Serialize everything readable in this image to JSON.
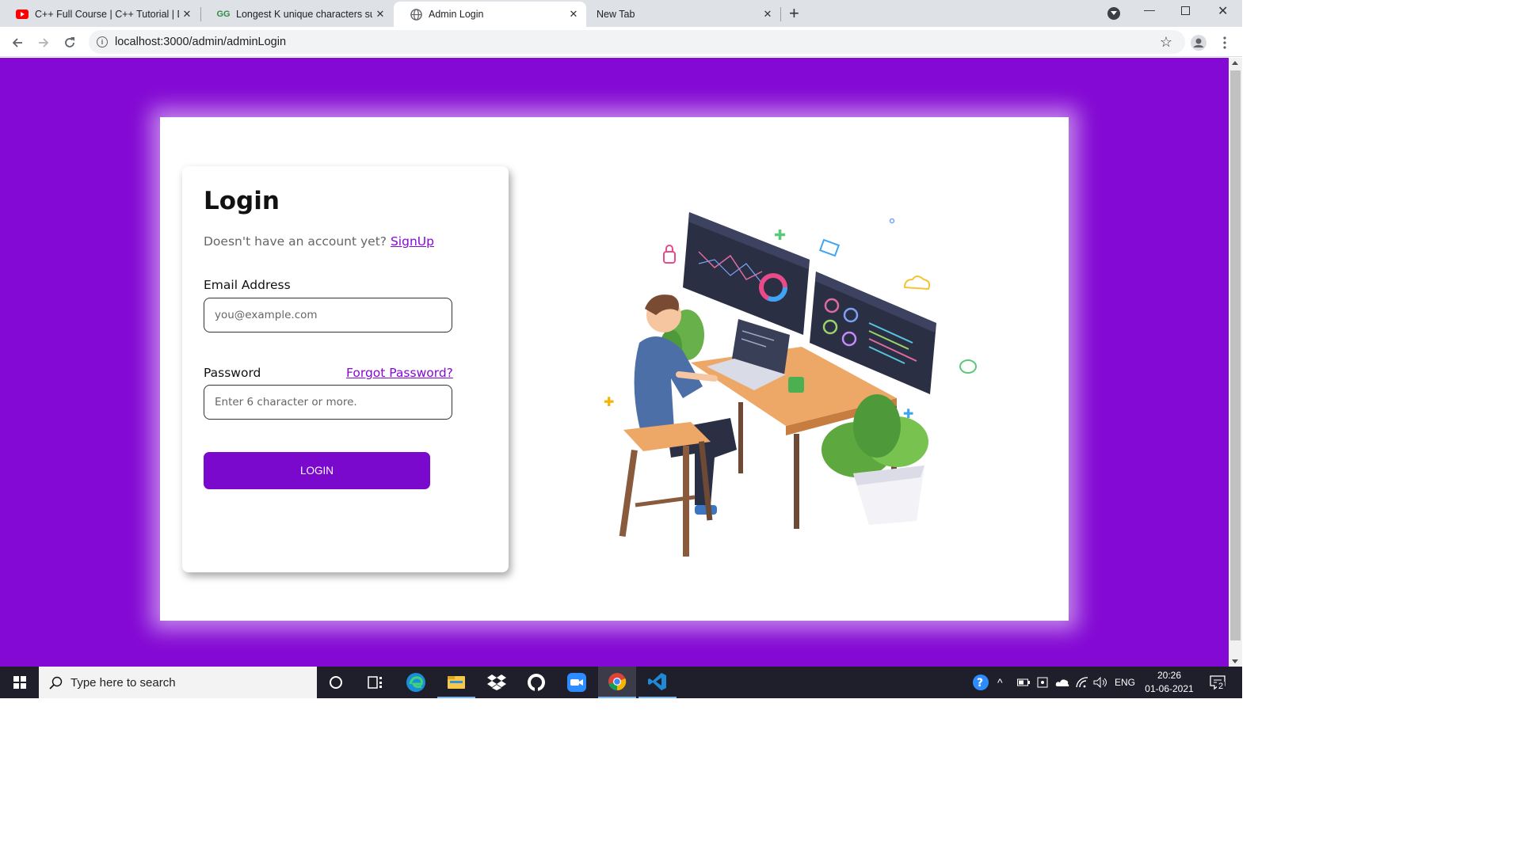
{
  "browser": {
    "tabs": [
      {
        "title": "C++ Full Course | C++ Tutorial | Data Structures & Algorithms",
        "icon": "youtube-icon"
      },
      {
        "title": "Longest K unique characters substring",
        "icon": "geeksforgeeks-icon"
      },
      {
        "title": "Admin Login",
        "icon": "globe-icon",
        "active": true
      },
      {
        "title": "New Tab",
        "icon": "none"
      }
    ],
    "url": "localhost:3000/admin/adminLogin"
  },
  "login": {
    "heading": "Login",
    "no_account_text": "Doesn't have an account yet?",
    "signup_link": "SignUp",
    "email_label": "Email Address",
    "email_placeholder": "you@example.com",
    "password_label": "Password",
    "forgot_link": "Forgot Password?",
    "password_placeholder": "Enter 6 character or more.",
    "login_button": "LOGIN"
  },
  "colors": {
    "page_background": "#8409d4",
    "button": "#7b08cd",
    "link": "#8409d4"
  },
  "taskbar": {
    "search_placeholder": "Type here to search",
    "language": "ENG",
    "time": "20:26",
    "date": "01-06-2021",
    "notification_count": "2",
    "pinned_apps": [
      "cortana-icon",
      "task-view-icon",
      "edge-icon",
      "file-explorer-icon",
      "dropbox-icon",
      "github-icon",
      "zoom-icon",
      "chrome-icon",
      "vscode-icon"
    ]
  }
}
